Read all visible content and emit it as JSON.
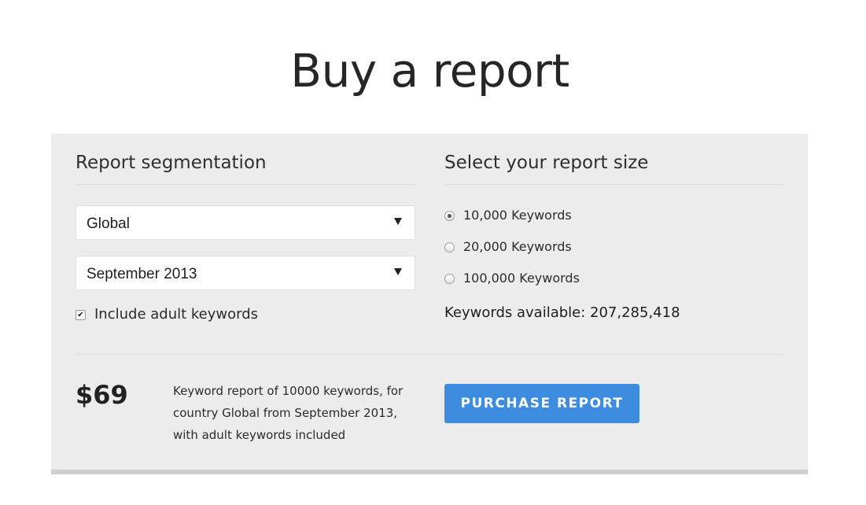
{
  "page": {
    "title": "Buy a report"
  },
  "segmentation": {
    "heading": "Report segmentation",
    "country_select": {
      "value": "Global"
    },
    "month_select": {
      "value": "September 2013"
    },
    "adult_checkbox": {
      "label": "Include adult keywords",
      "checked": true
    }
  },
  "report_size": {
    "heading": "Select your report size",
    "options": [
      {
        "label": "10,000 Keywords",
        "selected": true
      },
      {
        "label": "20,000 Keywords",
        "selected": false
      },
      {
        "label": "100,000 Keywords",
        "selected": false
      }
    ],
    "available_text": "Keywords available: 207,285,418"
  },
  "summary": {
    "price": "$69",
    "line1": "Keyword report of 10000 keywords, for",
    "line2": "country Global from September 2013,",
    "line3": "with adult keywords included",
    "purchase_label": "PURCHASE REPORT"
  },
  "colors": {
    "accent": "#3d8ce0",
    "panel_bg": "#ececec"
  }
}
